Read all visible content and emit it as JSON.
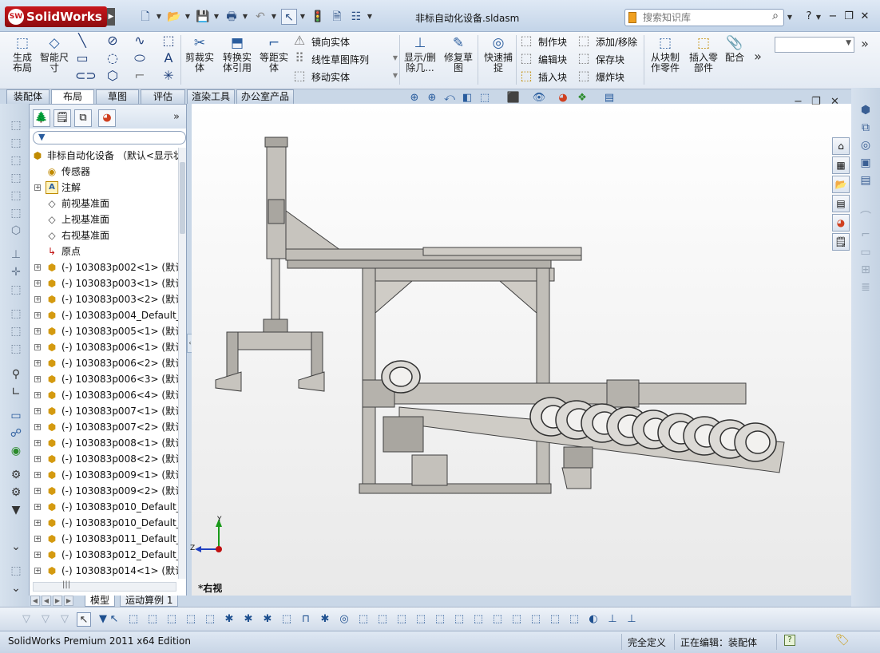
{
  "app": {
    "logo_text": "SolidWorks",
    "logo_badge": "SW",
    "document_title": "非标自动化设备.sldasm"
  },
  "search": {
    "placeholder": "搜索知识库"
  },
  "command_manager": {
    "generate_layout": "生成\n布局",
    "smart_dimension": "智能尺\n寸",
    "trim_entities": "剪裁实\n体",
    "convert_entities": "转换实\n体引用",
    "offset_entities": "等距实\n体",
    "mirror_entities": "镜向实体",
    "linear_pattern": "线性草图阵列",
    "move_entities": "移动实体",
    "display_delete": "显示/删\n除几...",
    "repair_sketch": "修复草\n图",
    "quick_snap": "快速捕\n捉",
    "make_block": "制作块",
    "edit_block": "编辑块",
    "insert_block": "插入块",
    "add_remove": "添加/移除",
    "save_block": "保存块",
    "explode_block": "爆炸块",
    "make_part_from_block": "从块制\n作零件",
    "insert_component": "插入零\n部件",
    "mate": "配合"
  },
  "tabs": [
    "装配体",
    "布局",
    "草图",
    "评估",
    "渲染工具",
    "办公室产品"
  ],
  "active_tab": 1,
  "feature_tree": {
    "root": "非标自动化设备 （默认<显示状",
    "items": [
      {
        "expand": false,
        "icon": "sensor-icon",
        "label": "传感器"
      },
      {
        "expand": true,
        "icon": "annotation-icon",
        "label": "注解"
      },
      {
        "expand": false,
        "icon": "plane-icon",
        "label": "前视基准面"
      },
      {
        "expand": false,
        "icon": "plane-icon",
        "label": "上视基准面"
      },
      {
        "expand": false,
        "icon": "plane-icon",
        "label": "右视基准面"
      },
      {
        "expand": false,
        "icon": "origin-icon",
        "label": "原点"
      },
      {
        "expand": true,
        "icon": "part-icon",
        "label": "(-) 103083p002<1> (默认"
      },
      {
        "expand": true,
        "icon": "part-icon",
        "label": "(-) 103083p003<1> (默认"
      },
      {
        "expand": true,
        "icon": "part-icon",
        "label": "(-) 103083p003<2> (默认"
      },
      {
        "expand": true,
        "icon": "part-icon",
        "label": "(-) 103083p004_Default_"
      },
      {
        "expand": true,
        "icon": "part-icon",
        "label": "(-) 103083p005<1> (默认"
      },
      {
        "expand": true,
        "icon": "part-icon",
        "label": "(-) 103083p006<1> (默认"
      },
      {
        "expand": true,
        "icon": "part-icon",
        "label": "(-) 103083p006<2> (默认"
      },
      {
        "expand": true,
        "icon": "part-icon",
        "label": "(-) 103083p006<3> (默认"
      },
      {
        "expand": true,
        "icon": "part-icon",
        "label": "(-) 103083p006<4> (默认"
      },
      {
        "expand": true,
        "icon": "part-icon",
        "label": "(-) 103083p007<1> (默认"
      },
      {
        "expand": true,
        "icon": "part-icon",
        "label": "(-) 103083p007<2> (默认"
      },
      {
        "expand": true,
        "icon": "part-icon",
        "label": "(-) 103083p008<1> (默认"
      },
      {
        "expand": true,
        "icon": "part-icon",
        "label": "(-) 103083p008<2> (默认"
      },
      {
        "expand": true,
        "icon": "part-icon",
        "label": "(-) 103083p009<1> (默认"
      },
      {
        "expand": true,
        "icon": "part-icon",
        "label": "(-) 103083p009<2> (默认"
      },
      {
        "expand": true,
        "icon": "part-icon",
        "label": "(-) 103083p010_Default_"
      },
      {
        "expand": true,
        "icon": "part-icon",
        "label": "(-) 103083p010_Default_"
      },
      {
        "expand": true,
        "icon": "part-icon",
        "label": "(-) 103083p011_Default_"
      },
      {
        "expand": true,
        "icon": "part-icon",
        "label": "(-) 103083p012_Default_"
      },
      {
        "expand": true,
        "icon": "part-icon",
        "label": "(-) 103083p014<1> (默认"
      }
    ]
  },
  "graphics": {
    "view_name": "*右视",
    "triad_y": "Y",
    "triad_z": "Z"
  },
  "bottom_tabs": [
    "模型",
    "运动算例 1"
  ],
  "status": {
    "product": "SolidWorks Premium 2011 x64 Edition",
    "definition": "完全定义",
    "editing": "正在编辑：装配体",
    "help": "?"
  }
}
